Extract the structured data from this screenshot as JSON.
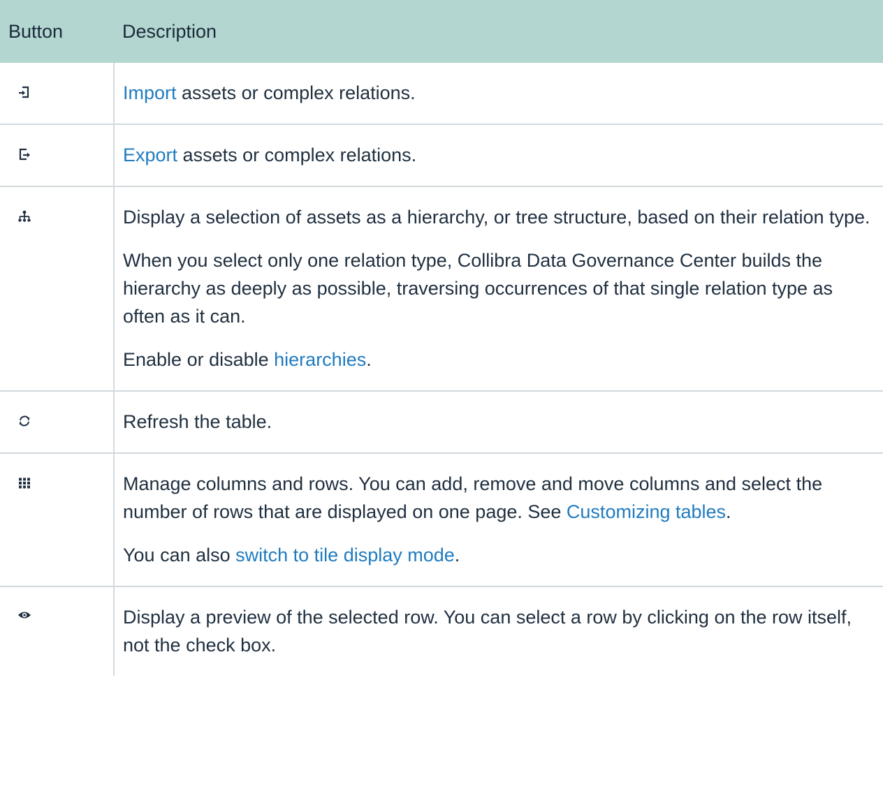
{
  "header": {
    "col_button": "Button",
    "col_description": "Description"
  },
  "rows": [
    {
      "icon": "import-icon",
      "p1": {
        "link": "Import",
        "rest": " assets or complex relations."
      }
    },
    {
      "icon": "export-icon",
      "p1": {
        "link": "Export",
        "rest": " assets or complex relations."
      }
    },
    {
      "icon": "hierarchy-icon",
      "p1": "Display a selection of assets as a hierarchy, or tree structure, based on their relation type.",
      "p2": "When you select only one relation type, Collibra Data Governance Center builds the hierarchy as deeply as possible, traversing occurrences of that single relation type as often as it can.",
      "p3": {
        "pre": "Enable or disable ",
        "link": "hierarchies",
        "post": "."
      }
    },
    {
      "icon": "refresh-icon",
      "p1": "Refresh the table."
    },
    {
      "icon": "grid-icon",
      "p1": {
        "pre": "Manage columns and rows. You can add, remove and move columns and select the number of rows that are displayed on one page. See ",
        "link": "Customizing tables",
        "post": "."
      },
      "p2": {
        "pre": "You can also ",
        "link": "switch to tile display mode",
        "post": "."
      }
    },
    {
      "icon": "eye-icon",
      "p1": "Display a preview of the selected row. You can select a row by clicking on the row itself, not the check box."
    }
  ]
}
